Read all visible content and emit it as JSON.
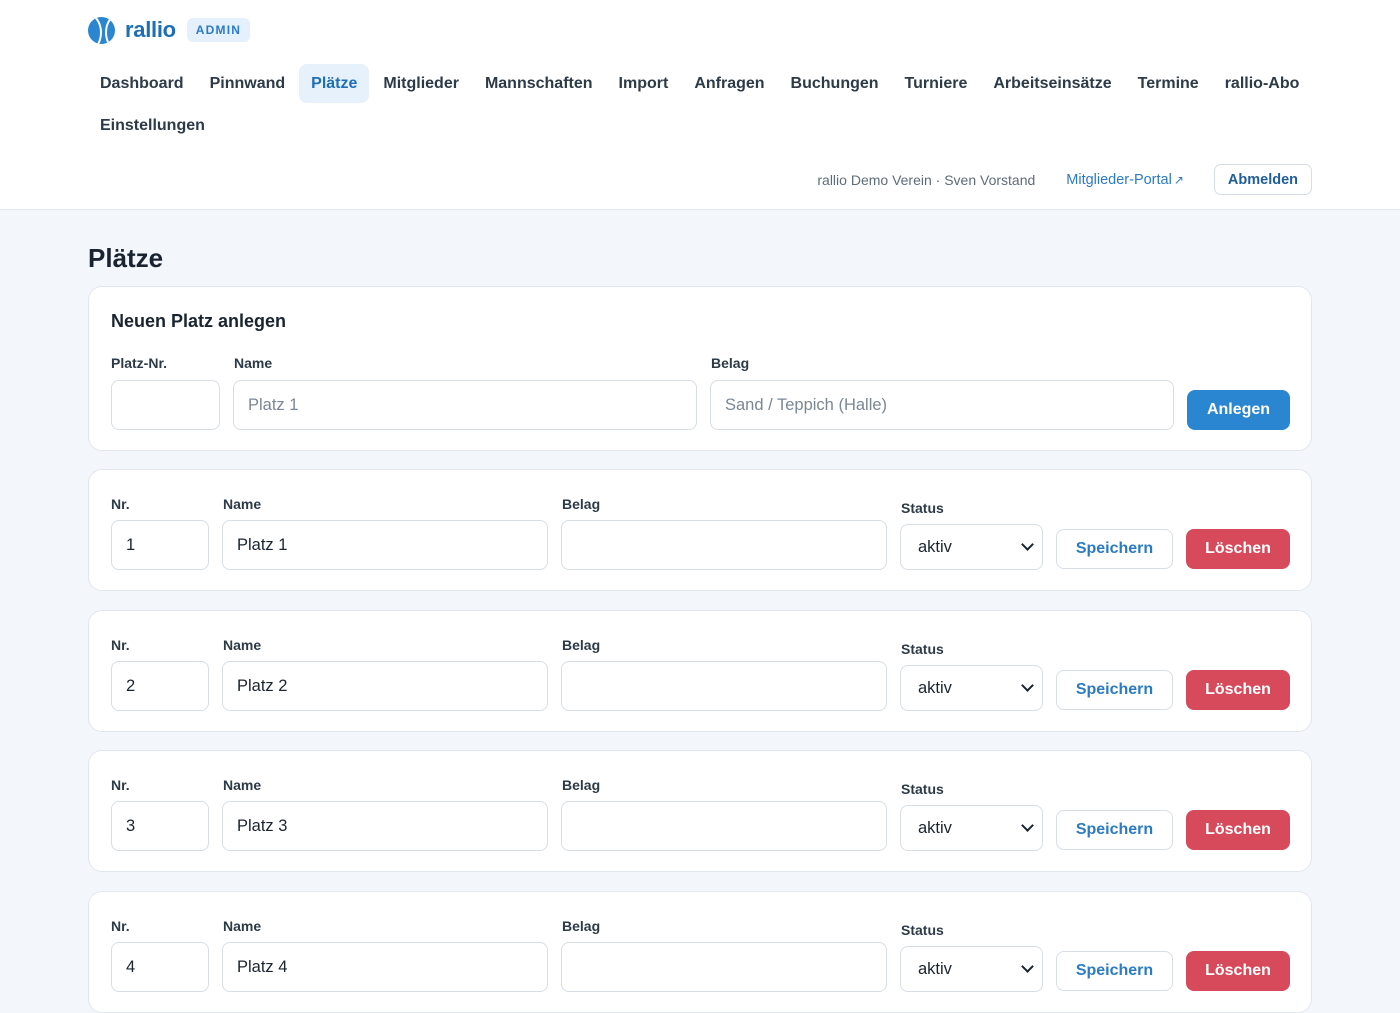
{
  "brand": {
    "name": "rallio",
    "badge": "ADMIN",
    "logo_icon": "tennis-ball-icon",
    "accent": "#2b86d1"
  },
  "nav": [
    {
      "label": "Dashboard",
      "active": false
    },
    {
      "label": "Pinnwand",
      "active": false
    },
    {
      "label": "Plätze",
      "active": true
    },
    {
      "label": "Mitglieder",
      "active": false
    },
    {
      "label": "Mannschaften",
      "active": false
    },
    {
      "label": "Import",
      "active": false
    },
    {
      "label": "Anfragen",
      "active": false
    },
    {
      "label": "Buchungen",
      "active": false
    },
    {
      "label": "Turniere",
      "active": false
    },
    {
      "label": "Arbeitseinsätze",
      "active": false
    },
    {
      "label": "Termine",
      "active": false
    },
    {
      "label": "rallio-Abo",
      "active": false
    },
    {
      "label": "Einstellungen",
      "active": false
    }
  ],
  "userbar": {
    "info": "rallio Demo Verein · Sven Vorstand",
    "portal_label": "Mitglieder-Portal",
    "portal_icon": "external-link-icon",
    "logout_label": "Abmelden"
  },
  "page": {
    "title": "Plätze"
  },
  "new_court": {
    "title": "Neuen Platz anlegen",
    "nr_label": "Platz-Nr.",
    "nr_value": "",
    "name_label": "Name",
    "name_placeholder": "Platz 1",
    "surface_label": "Belag",
    "surface_placeholder": "Sand / Teppich (Halle)",
    "submit_label": "Anlegen"
  },
  "row_labels": {
    "nr": "Nr.",
    "name": "Name",
    "surface": "Belag",
    "status": "Status",
    "save": "Speichern",
    "delete": "Löschen"
  },
  "courts": [
    {
      "nr": "1",
      "name": "Platz 1",
      "surface": "",
      "status": "aktiv"
    },
    {
      "nr": "2",
      "name": "Platz 2",
      "surface": "",
      "status": "aktiv"
    },
    {
      "nr": "3",
      "name": "Platz 3",
      "surface": "",
      "status": "aktiv"
    },
    {
      "nr": "4",
      "name": "Platz 4",
      "surface": "",
      "status": "aktiv"
    }
  ],
  "colors": {
    "primary": "#2b86d1",
    "danger": "#d64a5b",
    "background": "#f3f7fb"
  }
}
